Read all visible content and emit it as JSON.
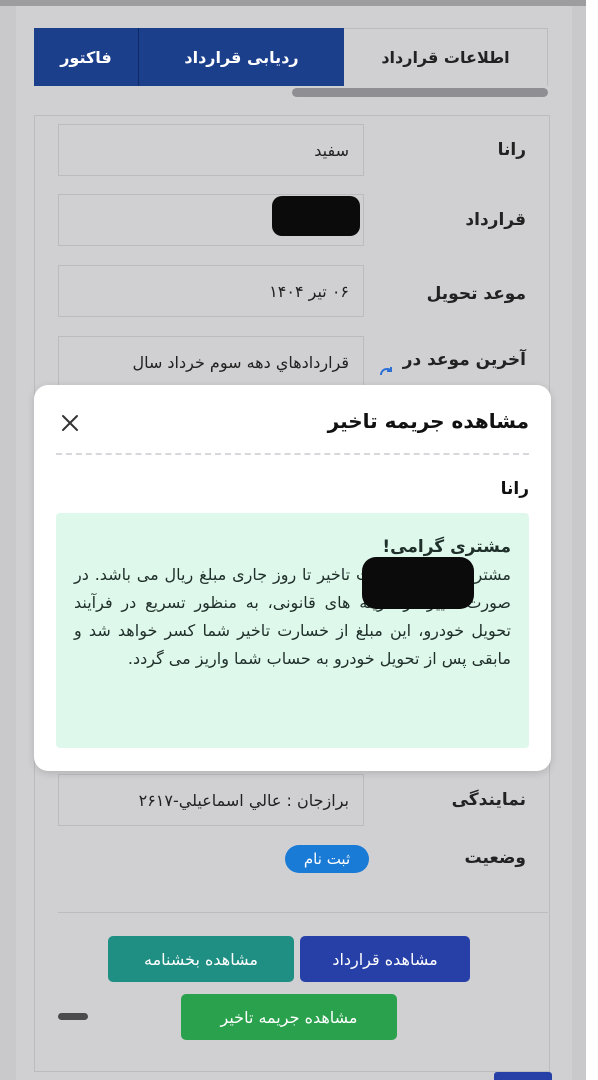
{
  "tabs": {
    "info": "اطلاعات قرارداد",
    "track": "ردیابی قرارداد",
    "invoice": "فاکتور"
  },
  "form": {
    "rows": [
      {
        "label": "رانا",
        "value": "سفید"
      },
      {
        "label": "قرارداد",
        "value": ""
      },
      {
        "label": "موعد تحویل",
        "value": "۰۶ تیر ۱۴۰۴"
      },
      {
        "label": "آخرین موعد در",
        "value": "قراردادهاي دهه سوم خرداد سال"
      }
    ],
    "agency_label": "نمایندگی",
    "agency_value": "برازجان : عالي اسماعيلي-۲۶۱۷",
    "status_label": "وضعیت",
    "status_value": "ثبت نام"
  },
  "modal": {
    "title": "مشاهده جریمه تاخیر",
    "subtitle": "رانا",
    "alert_heading": "مشتری گرامی!",
    "alert_body": "مشتری محترم خسارت تاخیر تا روز جاری مبلغ                ریال می باشد. در صورت تغییر در هزینه های قانونی، به منظور تسریع در فرآیند تحویل خودرو، این مبلغ از خسارت تاخیر شما کسر خواهد شد و مابقی پس از تحویل خودرو به حساب شما واریز می گردد."
  },
  "buttons": {
    "view_contract": "مشاهده قرارداد",
    "view_circular": "مشاهده بخشنامه",
    "view_penalty": "مشاهده جریمه تاخیر"
  },
  "icons": {
    "close": "close-icon",
    "refresh": "refresh-icon"
  },
  "colors": {
    "primary": "#1c3f8c",
    "teal": "#1f8f84",
    "green": "#2aa14c",
    "badge": "#1a7bd6",
    "alert_bg": "#dff8ec"
  }
}
